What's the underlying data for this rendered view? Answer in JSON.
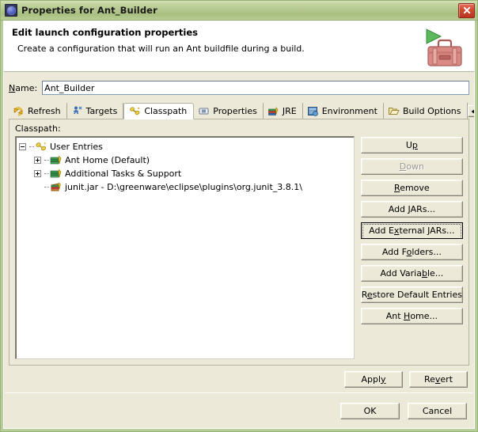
{
  "window": {
    "title": "Properties for Ant_Builder",
    "icon": "globe-icon",
    "close_label": "Close",
    "frame_color": "#b8ce9a",
    "client_color": "#ece9d8"
  },
  "banner": {
    "title": "Edit launch configuration properties",
    "description": "Create a configuration that will run an Ant buildfile during a build.",
    "icon": "ant-toolbox-icon"
  },
  "name_field": {
    "label": "Name:",
    "label_accesskey": "N",
    "value": "Ant_Builder",
    "placeholder": "Name"
  },
  "tabs": {
    "selected": "Classpath",
    "items": [
      {
        "label": "Refresh",
        "icon": "refresh-icon",
        "selected": false
      },
      {
        "label": "Targets",
        "icon": "targets-icon",
        "selected": false
      },
      {
        "label": "Classpath",
        "icon": "classpath-icon",
        "selected": true
      },
      {
        "label": "Properties",
        "icon": "properties-icon",
        "selected": false
      },
      {
        "label": "JRE",
        "icon": "jre-icon",
        "selected": false
      },
      {
        "label": "Environment",
        "icon": "environment-icon",
        "selected": false
      },
      {
        "label": "Build Options",
        "icon": "build-options-icon",
        "selected": false
      }
    ],
    "scroll_left": "scroll-left-arrow",
    "scroll_right": "scroll-right-arrow"
  },
  "classpath": {
    "label": "Classpath:",
    "tree": [
      {
        "label": "User Entries",
        "icon": "classpath-icon",
        "level": 1,
        "expander": "minus"
      },
      {
        "label": "Ant Home (Default)",
        "icon": "library-icon",
        "level": 2,
        "expander": "plus"
      },
      {
        "label": "Additional Tasks & Support",
        "icon": "library-icon",
        "level": 2,
        "expander": "plus"
      },
      {
        "label": "junit.jar - D:\\greenware\\eclipse\\plugins\\org.junit_3.8.1\\",
        "icon": "jar-icon",
        "level": 2,
        "expander": "none"
      }
    ],
    "buttons": [
      {
        "label": "Up",
        "state": "enabled",
        "accesskey": "p"
      },
      {
        "label": "Down",
        "state": "disabled",
        "accesskey": "D"
      },
      {
        "label": "Remove",
        "state": "enabled",
        "accesskey": "R"
      },
      {
        "label": "Add JARs...",
        "state": "enabled",
        "accesskey": "J"
      },
      {
        "label": "Add External JARs...",
        "state": "focused",
        "accesskey": "x"
      },
      {
        "label": "Add Folders...",
        "state": "enabled",
        "accesskey": "l"
      },
      {
        "label": "Add Variable...",
        "state": "enabled",
        "accesskey": "b"
      },
      {
        "label": "Restore Default Entries",
        "state": "enabled",
        "accesskey": "e"
      },
      {
        "label": "Ant Home...",
        "state": "enabled",
        "accesskey": "H"
      }
    ]
  },
  "footer": {
    "apply": "Apply",
    "revert": "Revert",
    "ok": "OK",
    "cancel": "Cancel"
  }
}
